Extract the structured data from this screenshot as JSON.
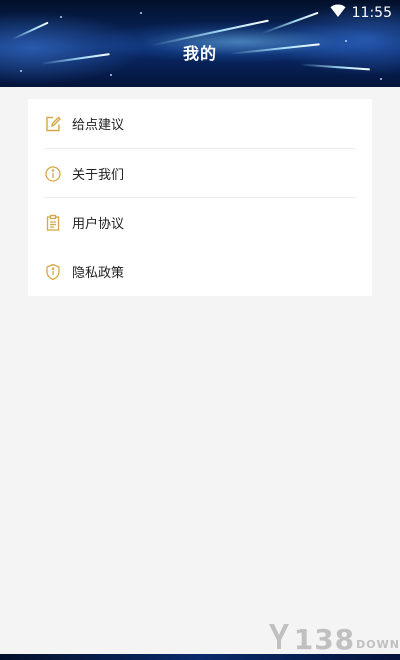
{
  "status_bar": {
    "time": "11:55",
    "wifi_icon": "wifi-icon"
  },
  "header": {
    "title": "我的"
  },
  "menu": {
    "items": [
      {
        "label": "给点建议",
        "icon": "edit-icon"
      },
      {
        "label": "关于我们",
        "icon": "info-circle-icon"
      },
      {
        "label": "用户协议",
        "icon": "clipboard-icon"
      },
      {
        "label": "隐私政策",
        "icon": "shield-icon"
      }
    ]
  },
  "watermark": {
    "main": "138",
    "suffix": "DOWN"
  },
  "colors": {
    "accent_icon": "#d6a843",
    "background": "#f4f4f4",
    "card": "#ffffff",
    "header_dark": "#03102a"
  }
}
